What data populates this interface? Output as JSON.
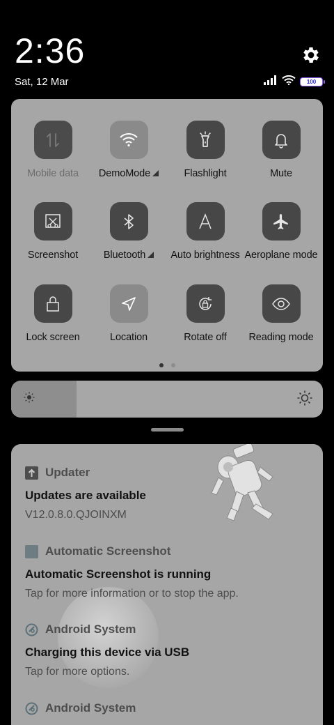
{
  "status_bar": {
    "time": "2:36",
    "date": "Sat, 12 Mar",
    "battery": "100",
    "icons": [
      "signal-icon",
      "wifi-icon",
      "battery-icon"
    ]
  },
  "quick_settings": {
    "tiles": [
      {
        "label": "Mobile data",
        "icon": "mobile-data-icon",
        "state": "unavailable"
      },
      {
        "label": "DemoMode",
        "icon": "wifi-icon",
        "state": "on",
        "expandable": true
      },
      {
        "label": "Flashlight",
        "icon": "flashlight-icon",
        "state": "off"
      },
      {
        "label": "Mute",
        "icon": "bell-icon",
        "state": "off"
      },
      {
        "label": "Screenshot",
        "icon": "screenshot-icon",
        "state": "off"
      },
      {
        "label": "Bluetooth",
        "icon": "bluetooth-icon",
        "state": "off",
        "expandable": true
      },
      {
        "label": "Auto brightness",
        "icon": "auto-brightness-icon",
        "state": "off"
      },
      {
        "label": "Aeroplane mode",
        "icon": "airplane-icon",
        "state": "off"
      },
      {
        "label": "Lock screen",
        "icon": "lock-icon",
        "state": "off"
      },
      {
        "label": "Location",
        "icon": "location-icon",
        "state": "on"
      },
      {
        "label": "Rotate off",
        "icon": "rotate-lock-icon",
        "state": "off"
      },
      {
        "label": "Reading mode",
        "icon": "eye-icon",
        "state": "off"
      }
    ],
    "page_count": 2,
    "current_page": 1
  },
  "brightness": {
    "level": 0.21
  },
  "notifications": [
    {
      "app": "Updater",
      "icon": "updater-icon",
      "title": "Updates are available",
      "text": "V12.0.8.0.QJOINXM"
    },
    {
      "app": "Automatic Screenshot",
      "icon": "screenshot-app-icon",
      "title": "Automatic Screenshot is running",
      "text": "Tap for more information or to stop the app."
    },
    {
      "app": "Android System",
      "icon": "android-system-icon",
      "title": "Charging this device via USB",
      "text": "Tap for more options."
    },
    {
      "app": "Android System",
      "icon": "android-system-icon",
      "title": "",
      "text": ""
    }
  ],
  "colors": {
    "tile_on": "#8a8a8a",
    "tile_off": "#474747",
    "panel": "#a6a6a6",
    "battery_accent": "#8b5cf6"
  }
}
